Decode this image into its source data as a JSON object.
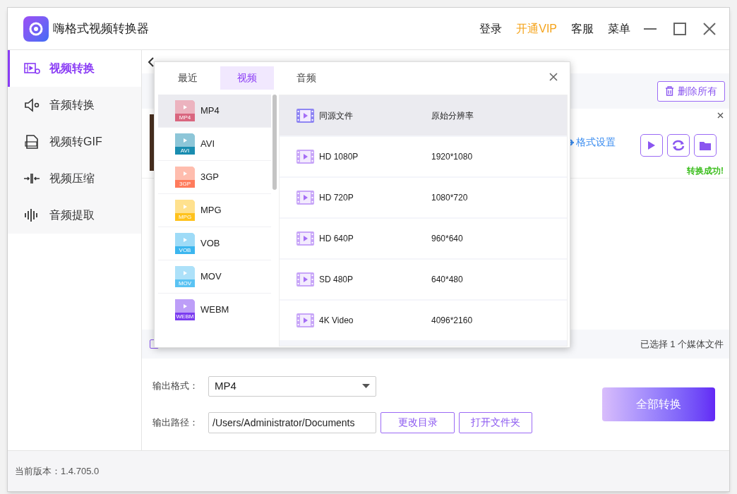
{
  "window": {
    "title": "嗨格式视频转换器",
    "header_links": [
      {
        "label": "登录",
        "kind": "normal"
      },
      {
        "label": "开通VIP",
        "kind": "vip"
      },
      {
        "label": "客服",
        "kind": "normal"
      },
      {
        "label": "菜单",
        "kind": "normal"
      }
    ]
  },
  "sidebar": {
    "items": [
      {
        "label": "视频转换",
        "kind": "video",
        "selected": true
      },
      {
        "label": "音频转换",
        "kind": "audio",
        "selected": false
      },
      {
        "label": "视频转GIF",
        "kind": "gif",
        "selected": false
      },
      {
        "label": "视频压缩",
        "kind": "compress",
        "selected": false
      },
      {
        "label": "音频提取",
        "kind": "extract",
        "selected": false
      }
    ]
  },
  "toolbar": {
    "delete_all": "删除所有"
  },
  "file_item": {
    "format_settings": "格式设置",
    "status": "转换成功!"
  },
  "selection_bar": {
    "checked": false,
    "summary": "已选择 1 个媒体文件"
  },
  "output": {
    "format_label": "输出格式：",
    "format_value": "MP4",
    "path_label": "输出路径：",
    "path_value": "/Users/Administrator/Documents",
    "change_dir": "更改目录",
    "open_folder": "打开文件夹",
    "convert_all": "全部转换"
  },
  "status_bar": {
    "version": "当前版本：1.4.705.0"
  },
  "format_popup": {
    "tabs": [
      {
        "label": "最近",
        "selected": false
      },
      {
        "label": "视频",
        "selected": true
      },
      {
        "label": "音频",
        "selected": false
      }
    ],
    "formats": [
      {
        "label": "MP4",
        "badge": "MP4",
        "color": "#d9667f",
        "selected": true
      },
      {
        "label": "AVI",
        "badge": "AVI",
        "color": "#1a8db0",
        "selected": false
      },
      {
        "label": "3GP",
        "badge": "3GP",
        "color": "#ff7b5c",
        "selected": false
      },
      {
        "label": "MPG",
        "badge": "MPG",
        "color": "#ffc21c",
        "selected": false
      },
      {
        "label": "VOB",
        "badge": "VOB",
        "color": "#3cb6ef",
        "selected": false
      },
      {
        "label": "MOV",
        "badge": "MOV",
        "color": "#5ac3f3",
        "selected": false
      },
      {
        "label": "WEBM",
        "badge": "WEBM",
        "color": "#7b3cf0",
        "selected": false
      }
    ],
    "presets": [
      {
        "name": "同源文件",
        "resolution": "原始分辨率",
        "selected": true
      },
      {
        "name": "HD 1080P",
        "resolution": "1920*1080",
        "selected": false
      },
      {
        "name": "HD 720P",
        "resolution": "1080*720",
        "selected": false
      },
      {
        "name": "HD 640P",
        "resolution": "960*640",
        "selected": false
      },
      {
        "name": "SD 480P",
        "resolution": "640*480",
        "selected": false
      },
      {
        "name": "4K Video",
        "resolution": "4096*2160",
        "selected": false
      }
    ]
  }
}
